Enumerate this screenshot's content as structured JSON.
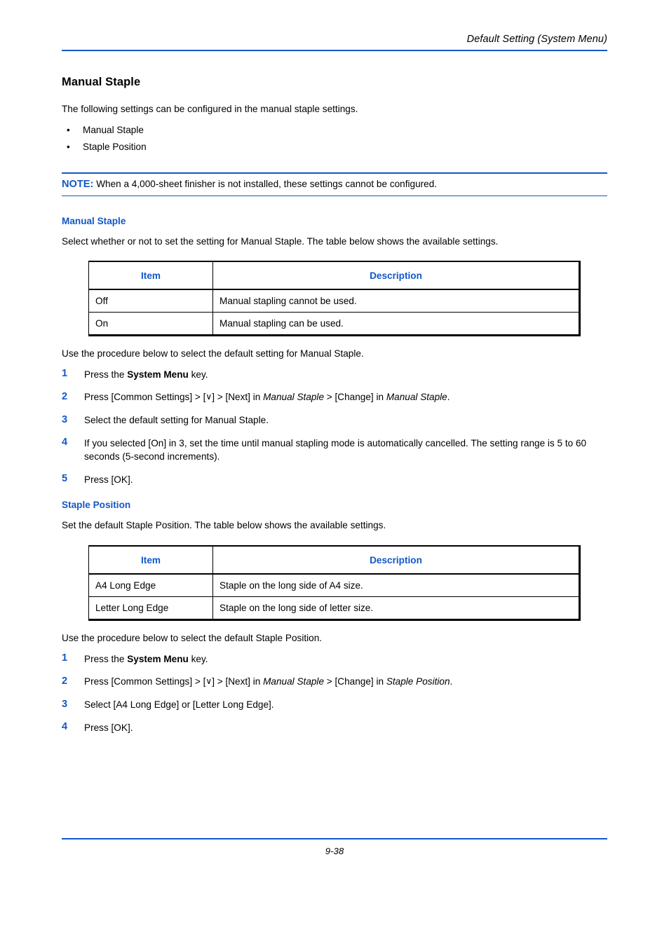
{
  "page": {
    "running_header": "Default Setting (System Menu)",
    "footer_page_number": "9-38",
    "accent_blue": "#1258c8",
    "text_color": "#000000",
    "background": "#ffffff"
  },
  "section": {
    "title": "Manual Staple",
    "intro": "The following settings can be configured in the manual staple settings.",
    "bullets": [
      {
        "marker": "•",
        "label": "Manual Staple"
      },
      {
        "marker": "•",
        "label": "Staple Position"
      }
    ]
  },
  "note": {
    "label": "NOTE:",
    "text": "When a 4,000-sheet finisher is not installed, these settings cannot be configured."
  },
  "manual_staple": {
    "heading": "Manual Staple",
    "intro": "Select whether or not to set the setting for Manual Staple. The table below shows the available settings.",
    "table": {
      "headers": [
        "Item",
        "Description"
      ],
      "rows": [
        [
          "Off",
          "Manual stapling cannot be used."
        ],
        [
          "On",
          "Manual stapling can be used."
        ]
      ]
    },
    "procedure_intro": "Use the procedure below to select the default setting for Manual Staple.",
    "steps": [
      {
        "num": "1",
        "text_parts": [
          {
            "t": "Press the ",
            "style": "normal"
          },
          {
            "t": "System Menu",
            "style": "bold"
          },
          {
            "t": " key.",
            "style": "normal"
          }
        ]
      },
      {
        "num": "2",
        "text_parts": [
          {
            "t": "Press [Common Settings] > [",
            "style": "normal"
          },
          {
            "t": "∨",
            "style": "chevron"
          },
          {
            "t": "] > [Next] in ",
            "style": "normal"
          },
          {
            "t": "Manual Staple",
            "style": "italic"
          },
          {
            "t": " > [Change] in ",
            "style": "normal"
          },
          {
            "t": "Manual Staple",
            "style": "italic"
          },
          {
            "t": ".",
            "style": "normal"
          }
        ]
      },
      {
        "num": "3",
        "text_parts": [
          {
            "t": "Select the default setting for Manual Staple.",
            "style": "normal"
          }
        ]
      },
      {
        "num": "4",
        "text_parts": [
          {
            "t": "If you selected [On] in 3, set the time until manual stapling mode is automatically cancelled. The setting range is 5 to 60 seconds (5-second increments).",
            "style": "normal"
          }
        ]
      },
      {
        "num": "5",
        "text_parts": [
          {
            "t": "Press [OK].",
            "style": "normal"
          }
        ]
      }
    ]
  },
  "staple_position": {
    "heading": "Staple Position",
    "intro": "Set the default Staple Position. The table below shows the available settings.",
    "table": {
      "headers": [
        "Item",
        "Description"
      ],
      "rows": [
        [
          "A4 Long Edge",
          "Staple on the long side of A4 size."
        ],
        [
          "Letter Long Edge",
          "Staple on the long side of letter size."
        ]
      ]
    },
    "procedure_intro": "Use the procedure below to select the default Staple Position.",
    "steps": [
      {
        "num": "1",
        "text_parts": [
          {
            "t": "Press the ",
            "style": "normal"
          },
          {
            "t": "System Menu",
            "style": "bold"
          },
          {
            "t": " key.",
            "style": "normal"
          }
        ]
      },
      {
        "num": "2",
        "text_parts": [
          {
            "t": "Press [Common Settings] > [",
            "style": "normal"
          },
          {
            "t": "∨",
            "style": "chevron"
          },
          {
            "t": "] > [Next] in ",
            "style": "normal"
          },
          {
            "t": "Manual Staple",
            "style": "italic"
          },
          {
            "t": " > [Change] in ",
            "style": "normal"
          },
          {
            "t": "Staple Position",
            "style": "italic"
          },
          {
            "t": ".",
            "style": "normal"
          }
        ]
      },
      {
        "num": "3",
        "text_parts": [
          {
            "t": "Select [A4 Long Edge] or [Letter Long Edge].",
            "style": "normal"
          }
        ]
      },
      {
        "num": "4",
        "text_parts": [
          {
            "t": "Press [OK].",
            "style": "normal"
          }
        ]
      }
    ]
  }
}
